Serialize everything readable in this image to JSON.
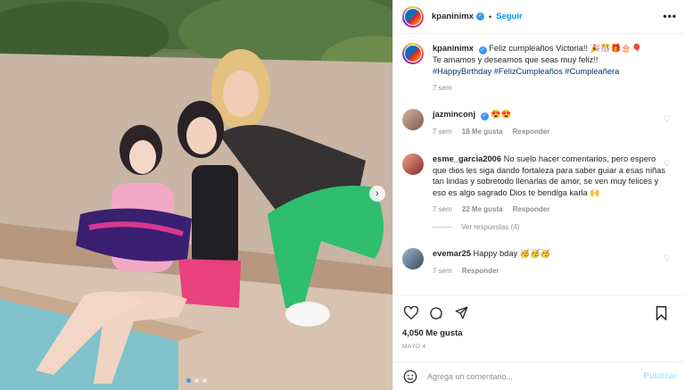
{
  "post": {
    "username": "kpaninimx",
    "follow_label": "Seguir",
    "more_label": "•••",
    "caption_line1": "Feliz cumpleaños Victoria!! 🎉🎊🎁🎂🎈",
    "caption_line2": "Te amamos y deseamos que seas muy feliz!!",
    "hashtags": "#HappyBirthday #FelizCumpleaños #Cumpleañera",
    "caption_time": "7 sem"
  },
  "comments": [
    {
      "user": "jazminconj",
      "verified": true,
      "text": "😍😍",
      "time": "7 sem",
      "likes": "18 Me gusta",
      "reply": "Responder"
    },
    {
      "user": "esme_garcia2006",
      "verified": false,
      "text": "No suelo hacer comentarios, pero espero que dios les siga dando fortaleza para saber guiar a esas niñas tan lindas y sobretodo llenarlas de amor, se ven muy felices y eso es algo sagrado Dios te bendiga karla 🙌",
      "time": "7 sem",
      "likes": "22 Me gusta",
      "reply": "Responder",
      "view_replies": "Ver respuestas (4)"
    },
    {
      "user": "evemar25",
      "verified": false,
      "text": "Happy bday 🥳🥳🥳",
      "time": "7 sem",
      "reply": "Responder"
    }
  ],
  "footer": {
    "likes": "4,050 Me gusta",
    "date": "MAYO 4",
    "comment_placeholder": "Agrega un comentario...",
    "publish_label": "Publicar"
  },
  "icons": {
    "heart": "heart-icon",
    "comment": "comment-icon",
    "share": "share-icon",
    "bookmark": "bookmark-icon",
    "emoji": "emoji-icon",
    "verified": "verified-badge-icon"
  },
  "colors": {
    "accent": "#0095f6",
    "publish_disabled": "#b2dffc",
    "meta_gray": "#8e8e8e",
    "hashtag": "#00376b"
  }
}
